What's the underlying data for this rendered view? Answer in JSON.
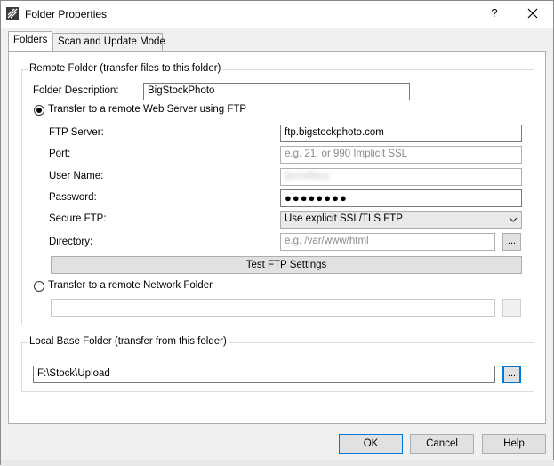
{
  "window": {
    "title": "Folder Properties",
    "help_glyph": "?",
    "icons": {
      "app": "app-icon",
      "help": "help-icon",
      "close": "close-icon"
    }
  },
  "tabs": [
    {
      "label": "Folders",
      "active": true
    },
    {
      "label": "Scan and Update Mode",
      "active": false
    }
  ],
  "remote_folder": {
    "title": "Remote Folder (transfer files to this folder)",
    "description_label": "Folder Description:",
    "description_value": "BigStockPhoto",
    "ftp_option_label": "Transfer to a remote Web Server using FTP",
    "ftp_option_selected": true,
    "ftp": {
      "server_label": "FTP Server:",
      "server_value": "ftp.bigstockphoto.com",
      "port_label": "Port:",
      "port_placeholder": "e.g. 21, or 990 Implicit SSL",
      "username_label": "User Name:",
      "username_value": "lancellazy",
      "password_label": "Password:",
      "password_value": "●●●●●●●●",
      "secure_label": "Secure FTP:",
      "secure_value": "Use explicit SSL/TLS FTP",
      "directory_label": "Directory:",
      "directory_placeholder": "e.g. /var/www/html",
      "browse_label": "...",
      "test_button": "Test FTP Settings"
    },
    "network_option_label": "Transfer to a remote Network Folder",
    "network_option_selected": false,
    "network_path_value": "",
    "network_browse_label": "..."
  },
  "local_folder": {
    "title": "Local Base Folder (transfer from this folder)",
    "path_value": "F:\\Stock\\Upload",
    "browse_label": "..."
  },
  "footer": {
    "ok": "OK",
    "cancel": "Cancel",
    "help": "Help"
  },
  "colors": {
    "focus_accent": "#0078d7",
    "dialog_bg": "#f0f0f0",
    "panel_bg": "#ffffff"
  }
}
